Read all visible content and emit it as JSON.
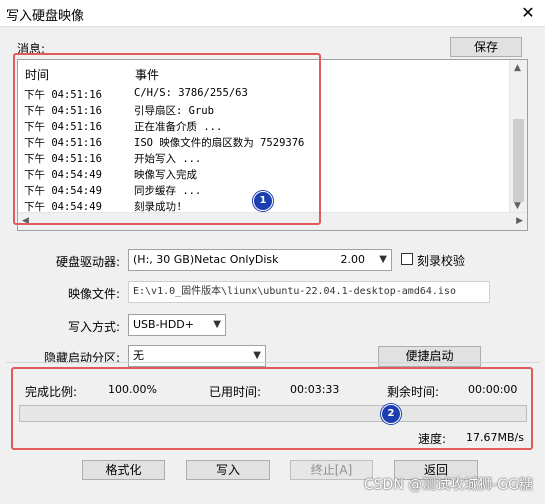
{
  "window": {
    "title": "写入硬盘映像",
    "close_glyph": "✕"
  },
  "messages": {
    "label": "消息:",
    "save_button": "保存",
    "col_time": "时间",
    "col_event": "事件",
    "rows": [
      {
        "time": "下午 04:51:16",
        "event": "C/H/S: 3786/255/63"
      },
      {
        "time": "下午 04:51:16",
        "event": "引导扇区: Grub"
      },
      {
        "time": "下午 04:51:16",
        "event": "正在准备介质 ..."
      },
      {
        "time": "下午 04:51:16",
        "event": "ISO 映像文件的扇区数为 7529376"
      },
      {
        "time": "下午 04:51:16",
        "event": "开始写入 ..."
      },
      {
        "time": "下午 04:54:49",
        "event": "映像写入完成"
      },
      {
        "time": "下午 04:54:49",
        "event": "同步缓存 ..."
      },
      {
        "time": "下午 04:54:49",
        "event": "刻录成功!"
      }
    ]
  },
  "annotations": {
    "badge1": "1",
    "badge2": "2",
    "highlight_color": "#e05b5b",
    "badge_color": "#1c3fb0"
  },
  "form": {
    "drive_label": "硬盘驱动器:",
    "drive_value": "(H:, 30 GB)Netac   OnlyDisk",
    "drive_version": "2.00",
    "verify_label": "刻录校验",
    "verify_checked": false,
    "image_label": "映像文件:",
    "image_value": "E:\\v1.0_固件版本\\liunx\\ubuntu-22.04.1-desktop-amd64.iso",
    "write_mode_label": "写入方式:",
    "write_mode_value": "USB-HDD+",
    "hidden_part_label": "隐藏启动分区:",
    "hidden_part_value": "无",
    "quick_boot_button": "便捷启动"
  },
  "progress": {
    "complete_label": "完成比例:",
    "complete_value": "100.00%",
    "elapsed_label": "已用时间:",
    "elapsed_value": "00:03:33",
    "remaining_label": "剩余时间:",
    "remaining_value": "00:00:00",
    "fraction": 0.0,
    "speed_label": "速度:",
    "speed_value": "17.67MB/s",
    "bar_color": "#06b025"
  },
  "buttons": {
    "format": "格式化",
    "write": "写入",
    "abort": "终止[A]",
    "back": "返回"
  },
  "watermark": "CSDN @测试攻城狮-GG糖"
}
